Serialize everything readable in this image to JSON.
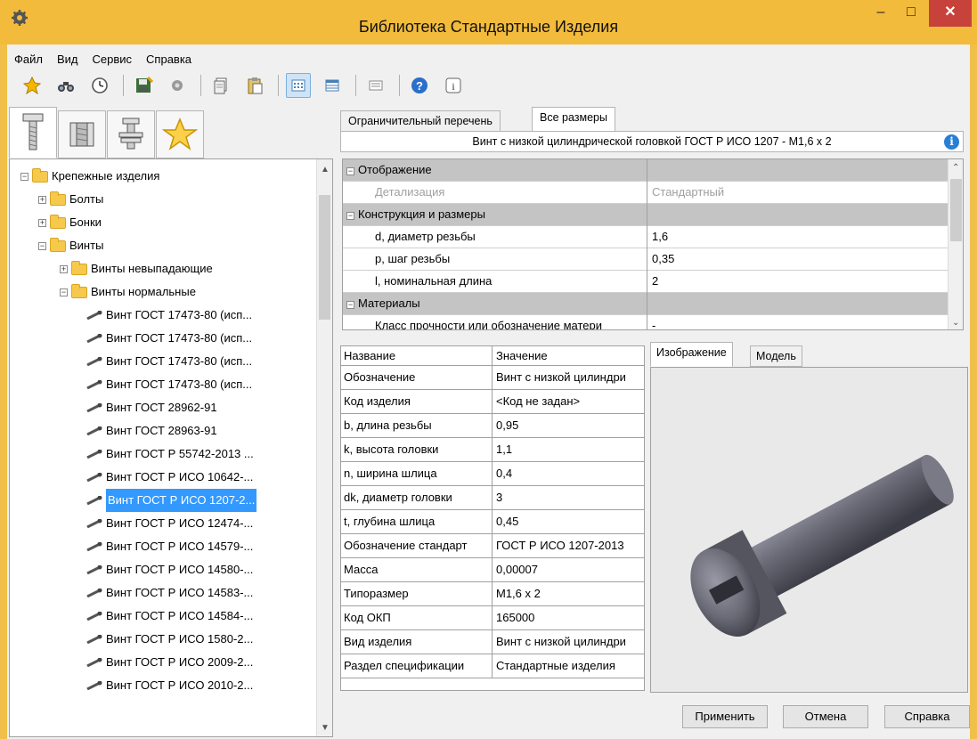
{
  "window": {
    "title": "Библиотека Стандартные Изделия",
    "minimize": "–",
    "maximize": "□",
    "close": "✕"
  },
  "menu": [
    "Файл",
    "Вид",
    "Сервис",
    "Справка"
  ],
  "toolbar": [
    "pin-icon",
    "binoculars-icon",
    "clock-icon",
    "save-icon",
    "gear-icon",
    "copy-icon",
    "paste-icon",
    "view-grid-icon",
    "view-table-icon",
    "view-list-icon",
    "help-icon",
    "info-icon"
  ],
  "left_tabs": [
    "bolt-icon",
    "nut-icon",
    "washer-icon",
    "favorites-star-icon"
  ],
  "tree": [
    {
      "label": "Крепежные изделия",
      "level": 0,
      "expander": "−",
      "type": "folder"
    },
    {
      "label": "Болты",
      "level": 1,
      "expander": "+",
      "type": "folder"
    },
    {
      "label": "Бонки",
      "level": 1,
      "expander": "+",
      "type": "folder"
    },
    {
      "label": "Винты",
      "level": 1,
      "expander": "−",
      "type": "folder"
    },
    {
      "label": "Винты невыпадающие",
      "level": 2,
      "expander": "+",
      "type": "folder"
    },
    {
      "label": "Винты нормальные",
      "level": 2,
      "expander": "−",
      "type": "folder"
    },
    {
      "label": "Винт ГОСТ 17473-80 (исп...",
      "level": 3,
      "type": "item"
    },
    {
      "label": "Винт ГОСТ 17473-80 (исп...",
      "level": 3,
      "type": "item"
    },
    {
      "label": "Винт ГОСТ 17473-80 (исп...",
      "level": 3,
      "type": "item"
    },
    {
      "label": "Винт ГОСТ 17473-80 (исп...",
      "level": 3,
      "type": "item"
    },
    {
      "label": "Винт ГОСТ 28962-91",
      "level": 3,
      "type": "item"
    },
    {
      "label": "Винт ГОСТ 28963-91",
      "level": 3,
      "type": "item"
    },
    {
      "label": "Винт ГОСТ Р 55742-2013 ...",
      "level": 3,
      "type": "item"
    },
    {
      "label": "Винт ГОСТ Р ИСО 10642-...",
      "level": 3,
      "type": "item"
    },
    {
      "label": "Винт ГОСТ Р ИСО 1207-2...",
      "level": 3,
      "type": "item",
      "selected": true
    },
    {
      "label": "Винт ГОСТ Р ИСО 12474-...",
      "level": 3,
      "type": "item"
    },
    {
      "label": "Винт ГОСТ Р ИСО 14579-...",
      "level": 3,
      "type": "item"
    },
    {
      "label": "Винт ГОСТ Р ИСО 14580-...",
      "level": 3,
      "type": "item"
    },
    {
      "label": "Винт ГОСТ Р ИСО 14583-...",
      "level": 3,
      "type": "item"
    },
    {
      "label": "Винт ГОСТ Р ИСО 14584-...",
      "level": 3,
      "type": "item"
    },
    {
      "label": "Винт ГОСТ Р ИСО 1580-2...",
      "level": 3,
      "type": "item"
    },
    {
      "label": "Винт ГОСТ Р ИСО 2009-2...",
      "level": 3,
      "type": "item"
    },
    {
      "label": "Винт ГОСТ Р ИСО 2010-2...",
      "level": 3,
      "type": "item"
    }
  ],
  "right_tabs": [
    "Ограничительный перечень",
    "Все размеры"
  ],
  "product_title": "Винт с низкой цилиндрической головкой ГОСТ Р ИСО 1207 - М1,6 x 2",
  "property_grid": [
    {
      "kind": "category",
      "name": "Отображение",
      "value": "",
      "expander": "−"
    },
    {
      "kind": "prop",
      "name": "Детализация",
      "value": "Стандартный",
      "disabled": true
    },
    {
      "kind": "category",
      "name": "Конструкция и размеры",
      "value": "",
      "expander": "−"
    },
    {
      "kind": "prop",
      "name": "d, диаметр резьбы",
      "value": "1,6"
    },
    {
      "kind": "prop",
      "name": "p, шаг резьбы",
      "value": "0,35"
    },
    {
      "kind": "prop",
      "name": "l, номинальная длина",
      "value": "2"
    },
    {
      "kind": "category",
      "name": "Материалы",
      "value": "",
      "expander": "−"
    },
    {
      "kind": "prop",
      "name": "Класс прочности или обозначение матери",
      "value": "-"
    }
  ],
  "params_table": {
    "headers": [
      "Название",
      "Значение"
    ],
    "rows": [
      [
        "Обозначение",
        "Винт с низкой цилиндри"
      ],
      [
        "Код изделия",
        "<Код не задан>"
      ],
      [
        "b, длина резьбы",
        "0,95"
      ],
      [
        "k, высота головки",
        "1,1"
      ],
      [
        "n, ширина шлица",
        "0,4"
      ],
      [
        "dk, диаметр головки",
        "3"
      ],
      [
        "t, глубина шлица",
        "0,45"
      ],
      [
        "Обозначение стандарт",
        "ГОСТ Р ИСО 1207-2013"
      ],
      [
        "Масса",
        "0,00007"
      ],
      [
        "Типоразмер",
        "М1,6 x 2"
      ],
      [
        "Код ОКП",
        "165000"
      ],
      [
        "Вид изделия",
        "Винт с низкой цилиндри"
      ],
      [
        "Раздел спецификации",
        "Стандартные изделия"
      ]
    ]
  },
  "image_tabs": [
    "Изображение",
    "Модель"
  ],
  "buttons": {
    "apply": "Применить",
    "cancel": "Отмена",
    "help": "Справка"
  }
}
